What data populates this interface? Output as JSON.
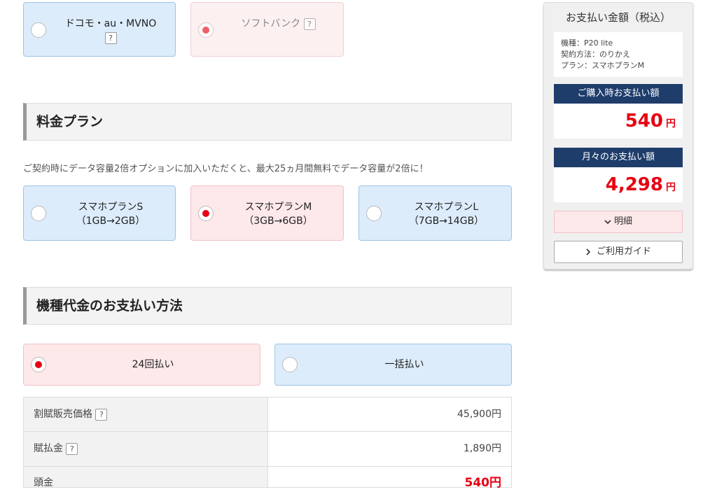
{
  "carrier": {
    "options": [
      {
        "label": "ドコモ・au・MVNO",
        "help": "?",
        "selected": false
      },
      {
        "label": "ソフトバンク",
        "help": "?",
        "selected": true
      }
    ]
  },
  "plan_section": {
    "title": "料金プラン",
    "note": "ご契約時にデータ容量2倍オプションに加入いただくと、最大25ヵ月間無料でデータ容量が2倍に！",
    "plans": [
      {
        "name": "スマホプランS",
        "detail": "（1GB→2GB）",
        "selected": false
      },
      {
        "name": "スマホプランM",
        "detail": "（3GB→6GB）",
        "selected": true
      },
      {
        "name": "スマホプランL",
        "detail": "（7GB→14GB）",
        "selected": false
      }
    ]
  },
  "payment_section": {
    "title": "機種代金のお支払い方法",
    "methods": [
      {
        "label": "24回払い",
        "selected": true
      },
      {
        "label": "一括払い",
        "selected": false
      }
    ],
    "rows": [
      {
        "label": "割賦販売価格",
        "help": "?",
        "value": "45,900円"
      },
      {
        "label": "賦払金",
        "help": "?",
        "value": "1,890円"
      },
      {
        "label": "頭金",
        "value": "540円"
      }
    ]
  },
  "summary": {
    "title": "お支払い金額（税込）",
    "info": [
      "機種：P20 lite",
      "契約方法：のりかえ",
      "プラン：スマホプランM"
    ],
    "purchase_label": "ご購入時お支払い額",
    "purchase_amount": "540",
    "monthly_label": "月々のお支払い額",
    "monthly_amount": "4,298",
    "yen": "円",
    "detail_button": "明細",
    "guide_button": "ご利用ガイド"
  },
  "colors": {
    "accent_red": "#e60012",
    "navy": "#1e3d6b",
    "card_blue": "#dcecfb",
    "card_pink": "#fde8ea"
  }
}
